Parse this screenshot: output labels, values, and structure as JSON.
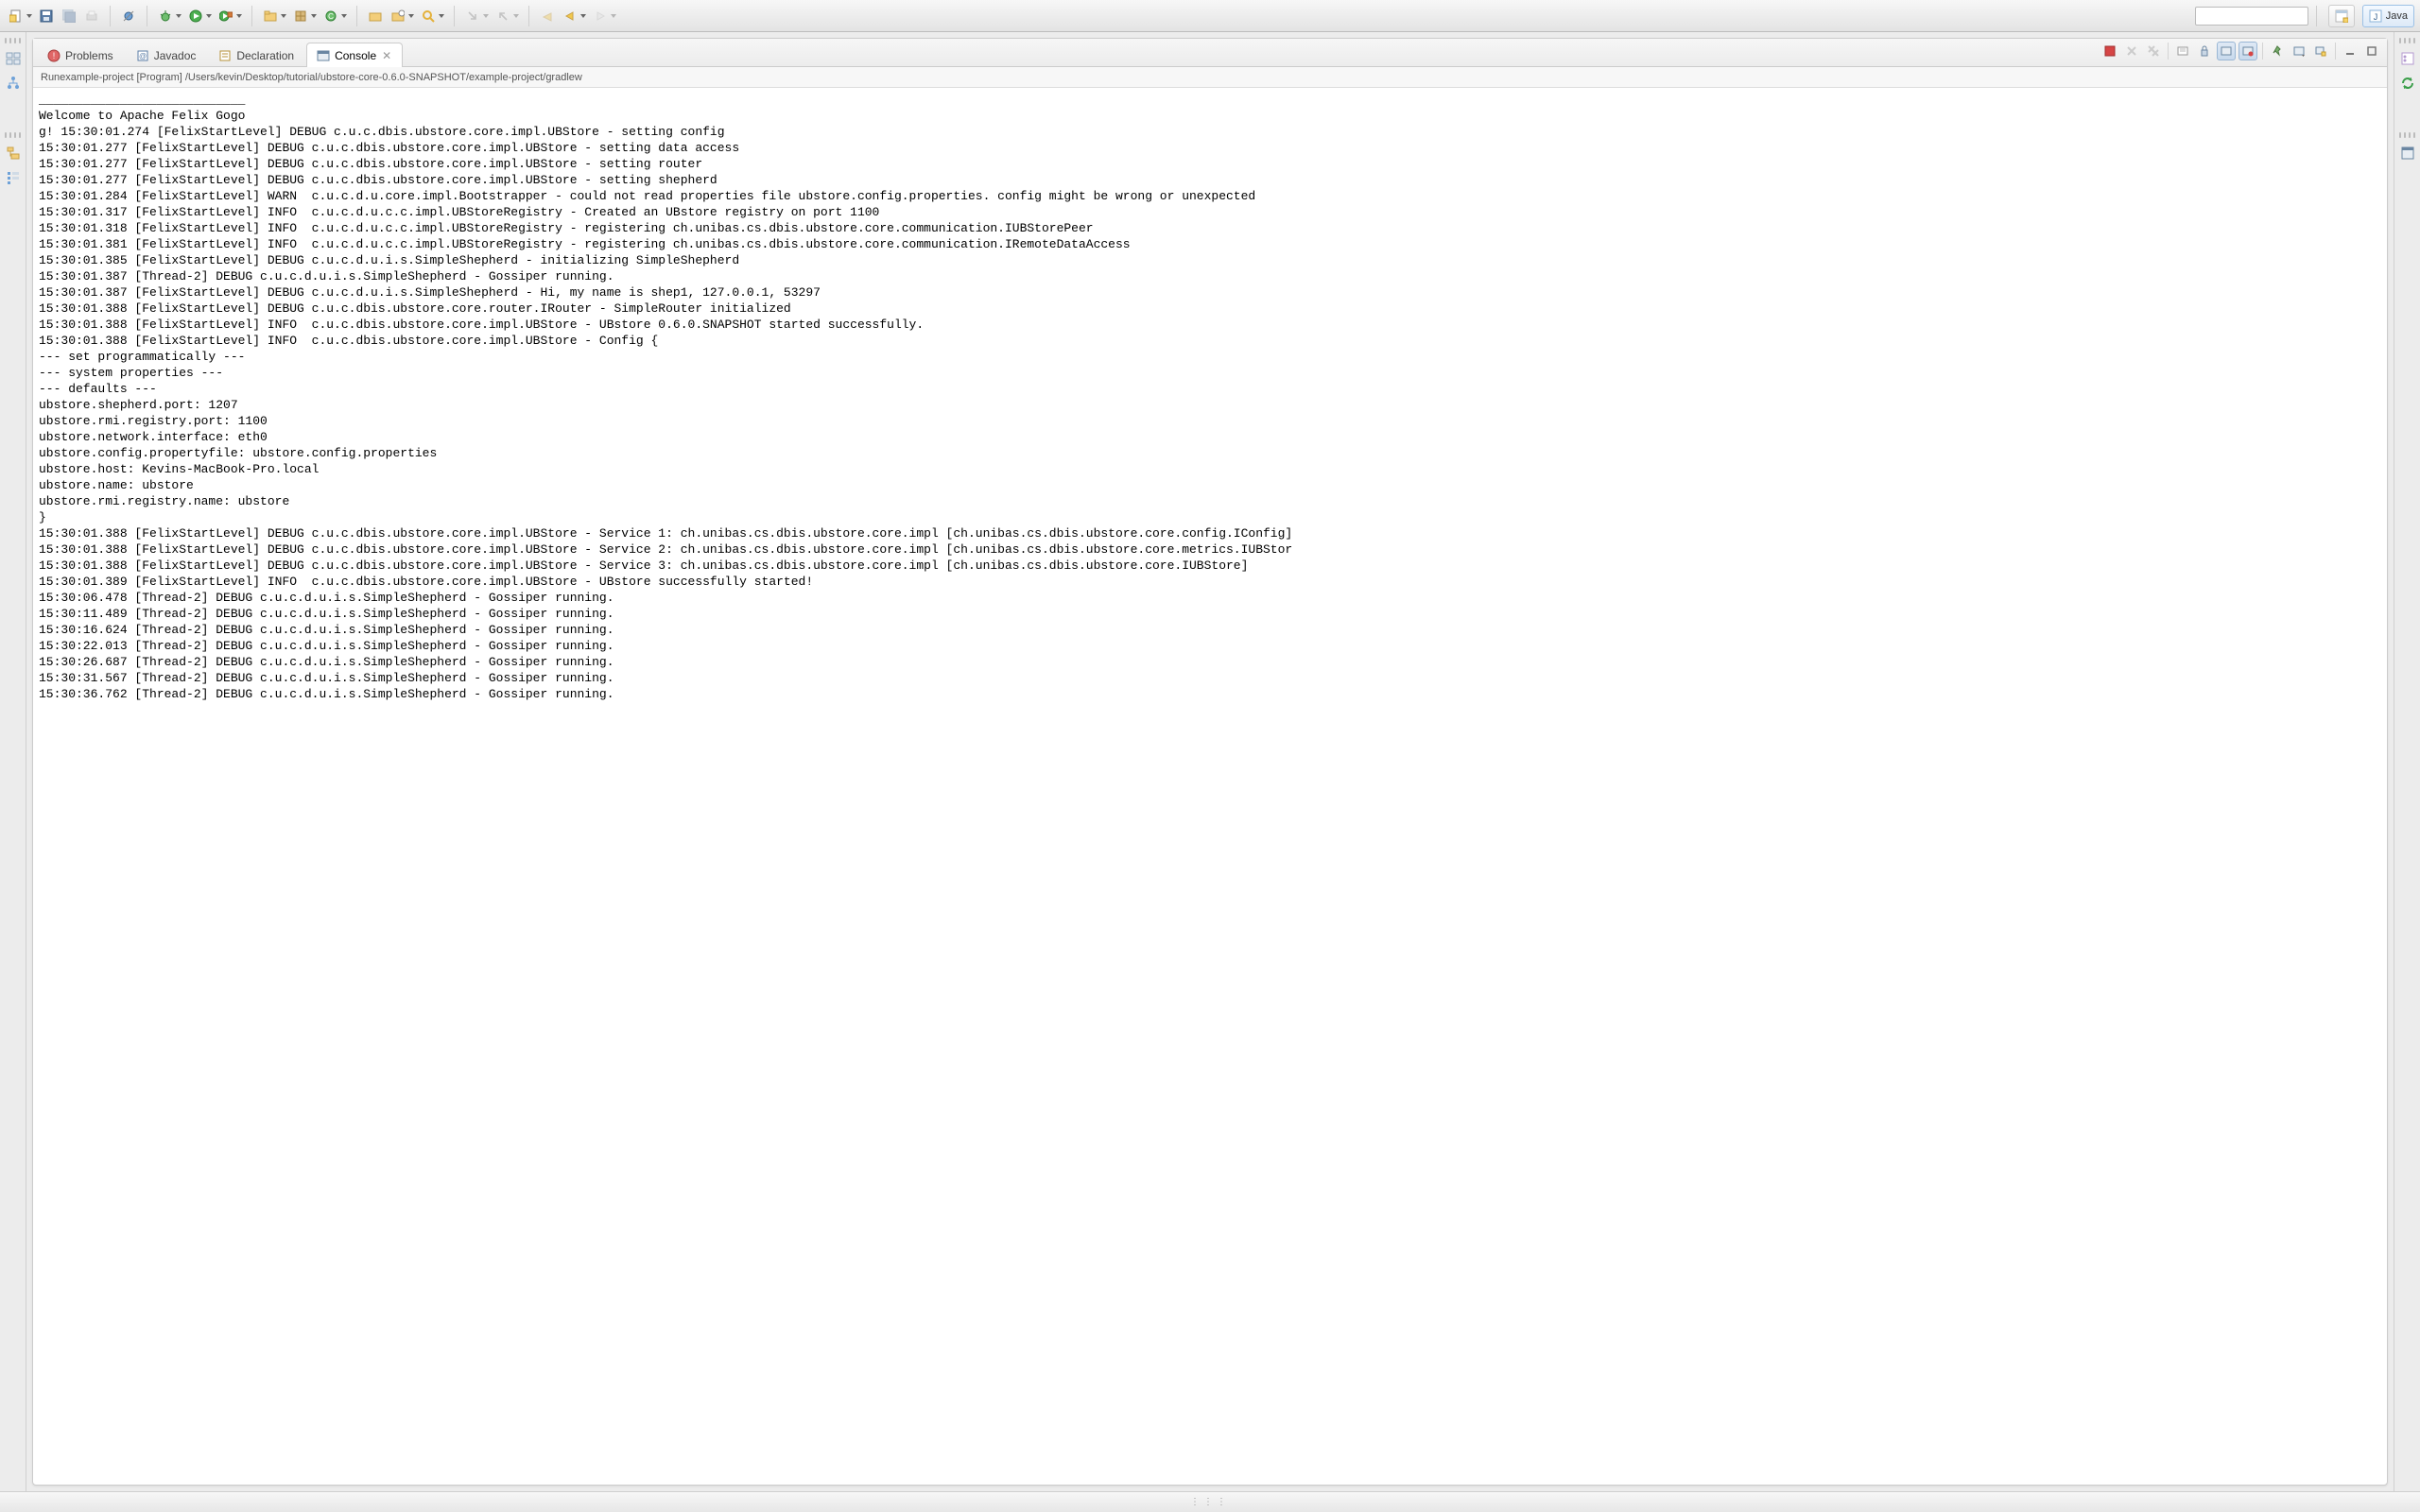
{
  "toolbar": {
    "searchPlaceholder": ""
  },
  "perspective": {
    "open_label": "",
    "java_label": "Java"
  },
  "tabs": {
    "problems": "Problems",
    "javadoc": "Javadoc",
    "declaration": "Declaration",
    "console": "Console"
  },
  "launch": {
    "description": "Runexample-project [Program] /Users/kevin/Desktop/tutorial/ubstore-core-0.6.0-SNAPSHOT/example-project/gradlew"
  },
  "console_lines": [
    "____________________________",
    "Welcome to Apache Felix Gogo",
    "",
    "g! 15:30:01.274 [FelixStartLevel] DEBUG c.u.c.dbis.ubstore.core.impl.UBStore - setting config",
    "15:30:01.277 [FelixStartLevel] DEBUG c.u.c.dbis.ubstore.core.impl.UBStore - setting data access",
    "15:30:01.277 [FelixStartLevel] DEBUG c.u.c.dbis.ubstore.core.impl.UBStore - setting router",
    "15:30:01.277 [FelixStartLevel] DEBUG c.u.c.dbis.ubstore.core.impl.UBStore - setting shepherd",
    "15:30:01.284 [FelixStartLevel] WARN  c.u.c.d.u.core.impl.Bootstrapper - could not read properties file ubstore.config.properties. config might be wrong or unexpected",
    "15:30:01.317 [FelixStartLevel] INFO  c.u.c.d.u.c.c.impl.UBStoreRegistry - Created an UBstore registry on port 1100",
    "15:30:01.318 [FelixStartLevel] INFO  c.u.c.d.u.c.c.impl.UBStoreRegistry - registering ch.unibas.cs.dbis.ubstore.core.communication.IUBStorePeer",
    "15:30:01.381 [FelixStartLevel] INFO  c.u.c.d.u.c.c.impl.UBStoreRegistry - registering ch.unibas.cs.dbis.ubstore.core.communication.IRemoteDataAccess",
    "15:30:01.385 [FelixStartLevel] DEBUG c.u.c.d.u.i.s.SimpleShepherd - initializing SimpleShepherd",
    "15:30:01.387 [Thread-2] DEBUG c.u.c.d.u.i.s.SimpleShepherd - Gossiper running.",
    "15:30:01.387 [FelixStartLevel] DEBUG c.u.c.d.u.i.s.SimpleShepherd - Hi, my name is shep1, 127.0.0.1, 53297",
    "15:30:01.388 [FelixStartLevel] DEBUG c.u.c.dbis.ubstore.core.router.IRouter - SimpleRouter initialized",
    "15:30:01.388 [FelixStartLevel] INFO  c.u.c.dbis.ubstore.core.impl.UBStore - UBstore 0.6.0.SNAPSHOT started successfully.",
    "15:30:01.388 [FelixStartLevel] INFO  c.u.c.dbis.ubstore.core.impl.UBStore - Config {",
    "--- set programmatically ---",
    "--- system properties ---",
    "--- defaults ---",
    "ubstore.shepherd.port: 1207",
    "ubstore.rmi.registry.port: 1100",
    "ubstore.network.interface: eth0",
    "ubstore.config.propertyfile: ubstore.config.properties",
    "ubstore.host: Kevins-MacBook-Pro.local",
    "ubstore.name: ubstore",
    "ubstore.rmi.registry.name: ubstore",
    "}",
    "15:30:01.388 [FelixStartLevel] DEBUG c.u.c.dbis.ubstore.core.impl.UBStore - Service 1: ch.unibas.cs.dbis.ubstore.core.impl [ch.unibas.cs.dbis.ubstore.core.config.IConfig]",
    "15:30:01.388 [FelixStartLevel] DEBUG c.u.c.dbis.ubstore.core.impl.UBStore - Service 2: ch.unibas.cs.dbis.ubstore.core.impl [ch.unibas.cs.dbis.ubstore.core.metrics.IUBStor",
    "15:30:01.388 [FelixStartLevel] DEBUG c.u.c.dbis.ubstore.core.impl.UBStore - Service 3: ch.unibas.cs.dbis.ubstore.core.impl [ch.unibas.cs.dbis.ubstore.core.IUBStore]",
    "15:30:01.389 [FelixStartLevel] INFO  c.u.c.dbis.ubstore.core.impl.UBStore - UBstore successfully started!",
    "15:30:06.478 [Thread-2] DEBUG c.u.c.d.u.i.s.SimpleShepherd - Gossiper running.",
    "15:30:11.489 [Thread-2] DEBUG c.u.c.d.u.i.s.SimpleShepherd - Gossiper running.",
    "15:30:16.624 [Thread-2] DEBUG c.u.c.d.u.i.s.SimpleShepherd - Gossiper running.",
    "15:30:22.013 [Thread-2] DEBUG c.u.c.d.u.i.s.SimpleShepherd - Gossiper running.",
    "15:30:26.687 [Thread-2] DEBUG c.u.c.d.u.i.s.SimpleShepherd - Gossiper running.",
    "15:30:31.567 [Thread-2] DEBUG c.u.c.d.u.i.s.SimpleShepherd - Gossiper running.",
    "15:30:36.762 [Thread-2] DEBUG c.u.c.d.u.i.s.SimpleShepherd - Gossiper running."
  ]
}
